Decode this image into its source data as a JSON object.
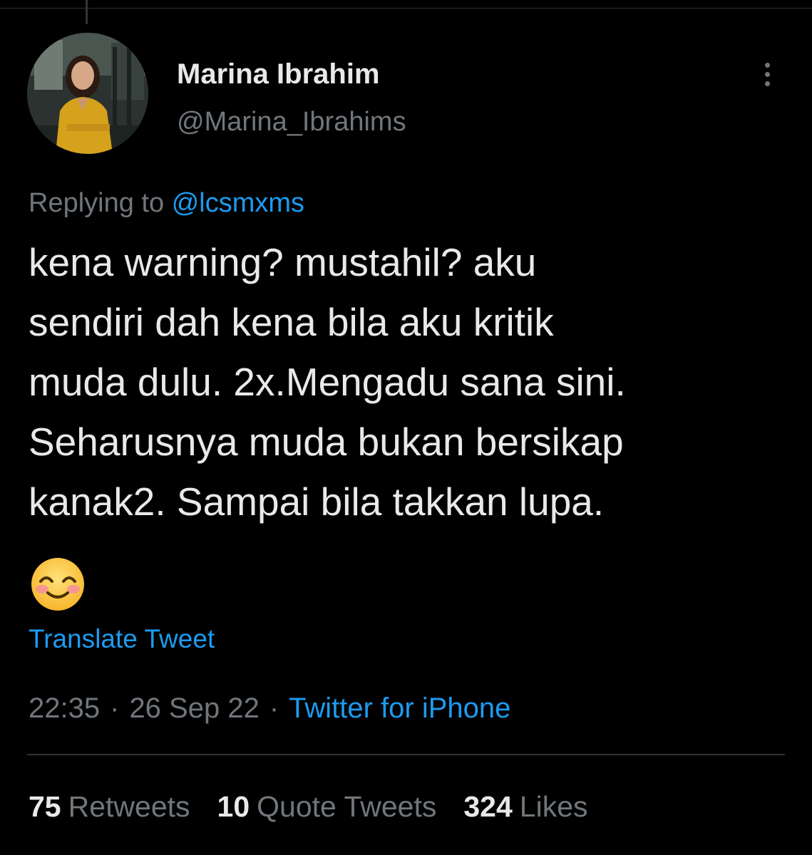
{
  "author": {
    "display_name": "Marina Ibrahim",
    "handle": "@Marina_Ibrahims"
  },
  "reply": {
    "prefix": "Replying to",
    "mention": "@lcsmxms"
  },
  "tweet": {
    "lines": [
      "kena warning? mustahil? aku",
      "sendiri dah kena bila aku kritik",
      "muda dulu. 2x.Mengadu sana sini.",
      "Seharusnya muda bukan bersikap",
      "kanak2. Sampai bila takkan lupa."
    ],
    "emoji": "smiling-face-with-smiling-eyes"
  },
  "translate_label": "Translate Tweet",
  "meta": {
    "time": "22:35",
    "date": "26 Sep 22",
    "separator": "·",
    "source": "Twitter for iPhone"
  },
  "stats": {
    "retweets": {
      "count": "75",
      "label": "Retweets"
    },
    "quotes": {
      "count": "10",
      "label": "Quote Tweets"
    },
    "likes": {
      "count": "324",
      "label": "Likes"
    }
  },
  "colors": {
    "background": "#000000",
    "text": "#e7e9ea",
    "secondary": "#71767b",
    "accent": "#1d9bf0",
    "divider": "#2f3336"
  }
}
